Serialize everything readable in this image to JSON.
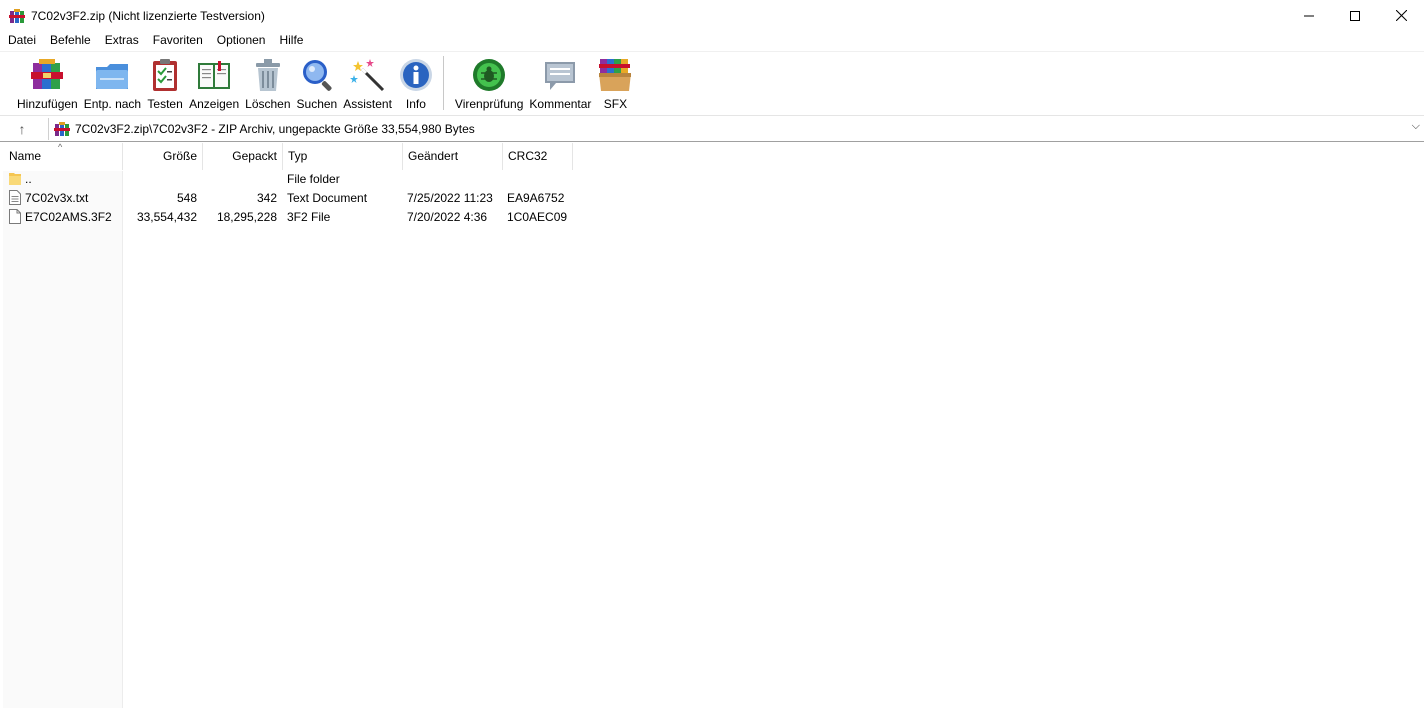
{
  "window": {
    "title": "7C02v3F2.zip (Nicht lizenzierte Testversion)",
    "minimize": "—",
    "maximize": "☐",
    "close": "✕"
  },
  "menu": [
    "Datei",
    "Befehle",
    "Extras",
    "Favoriten",
    "Optionen",
    "Hilfe"
  ],
  "toolbar": [
    {
      "label": "Hinzufügen",
      "icon": "add-archive-icon"
    },
    {
      "label": "Entp. nach",
      "icon": "extract-folder-icon"
    },
    {
      "label": "Testen",
      "icon": "test-clipboard-icon"
    },
    {
      "label": "Anzeigen",
      "icon": "view-book-icon"
    },
    {
      "label": "Löschen",
      "icon": "trash-icon"
    },
    {
      "label": "Suchen",
      "icon": "search-icon"
    },
    {
      "label": "Assistent",
      "icon": "wizard-wand-icon"
    },
    {
      "label": "Info",
      "icon": "info-icon"
    },
    {
      "label": "Virenprüfung",
      "icon": "virus-scan-icon"
    },
    {
      "label": "Kommentar",
      "icon": "comment-icon"
    },
    {
      "label": "SFX",
      "icon": "sfx-box-icon"
    }
  ],
  "address": {
    "up": "↑",
    "path": "7C02v3F2.zip\\7C02v3F2 - ZIP Archiv, ungepackte Größe 33,554,980 Bytes",
    "dropdown": "⌵"
  },
  "columns": {
    "name": "Name",
    "size": "Größe",
    "packed": "Gepackt",
    "type": "Typ",
    "modified": "Geändert",
    "crc": "CRC32",
    "sort_indicator": "^"
  },
  "rows": [
    {
      "name": "..",
      "size": "",
      "packed": "",
      "type": "File folder",
      "modified": "",
      "crc": "",
      "icon": "folder-icon"
    },
    {
      "name": "7C02v3x.txt",
      "size": "548",
      "packed": "342",
      "type": "Text Document",
      "modified": "7/25/2022 11:23",
      "crc": "EA9A6752",
      "icon": "text-file-icon"
    },
    {
      "name": "E7C02AMS.3F2",
      "size": "33,554,432",
      "packed": "18,295,228",
      "type": "3F2 File",
      "modified": "7/20/2022 4:36",
      "crc": "1C0AEC09",
      "icon": "file-icon"
    }
  ],
  "colors": {
    "accent_red": "#c8102e",
    "folder_yellow": "#f5c652",
    "divider": "#e5e5e5"
  }
}
